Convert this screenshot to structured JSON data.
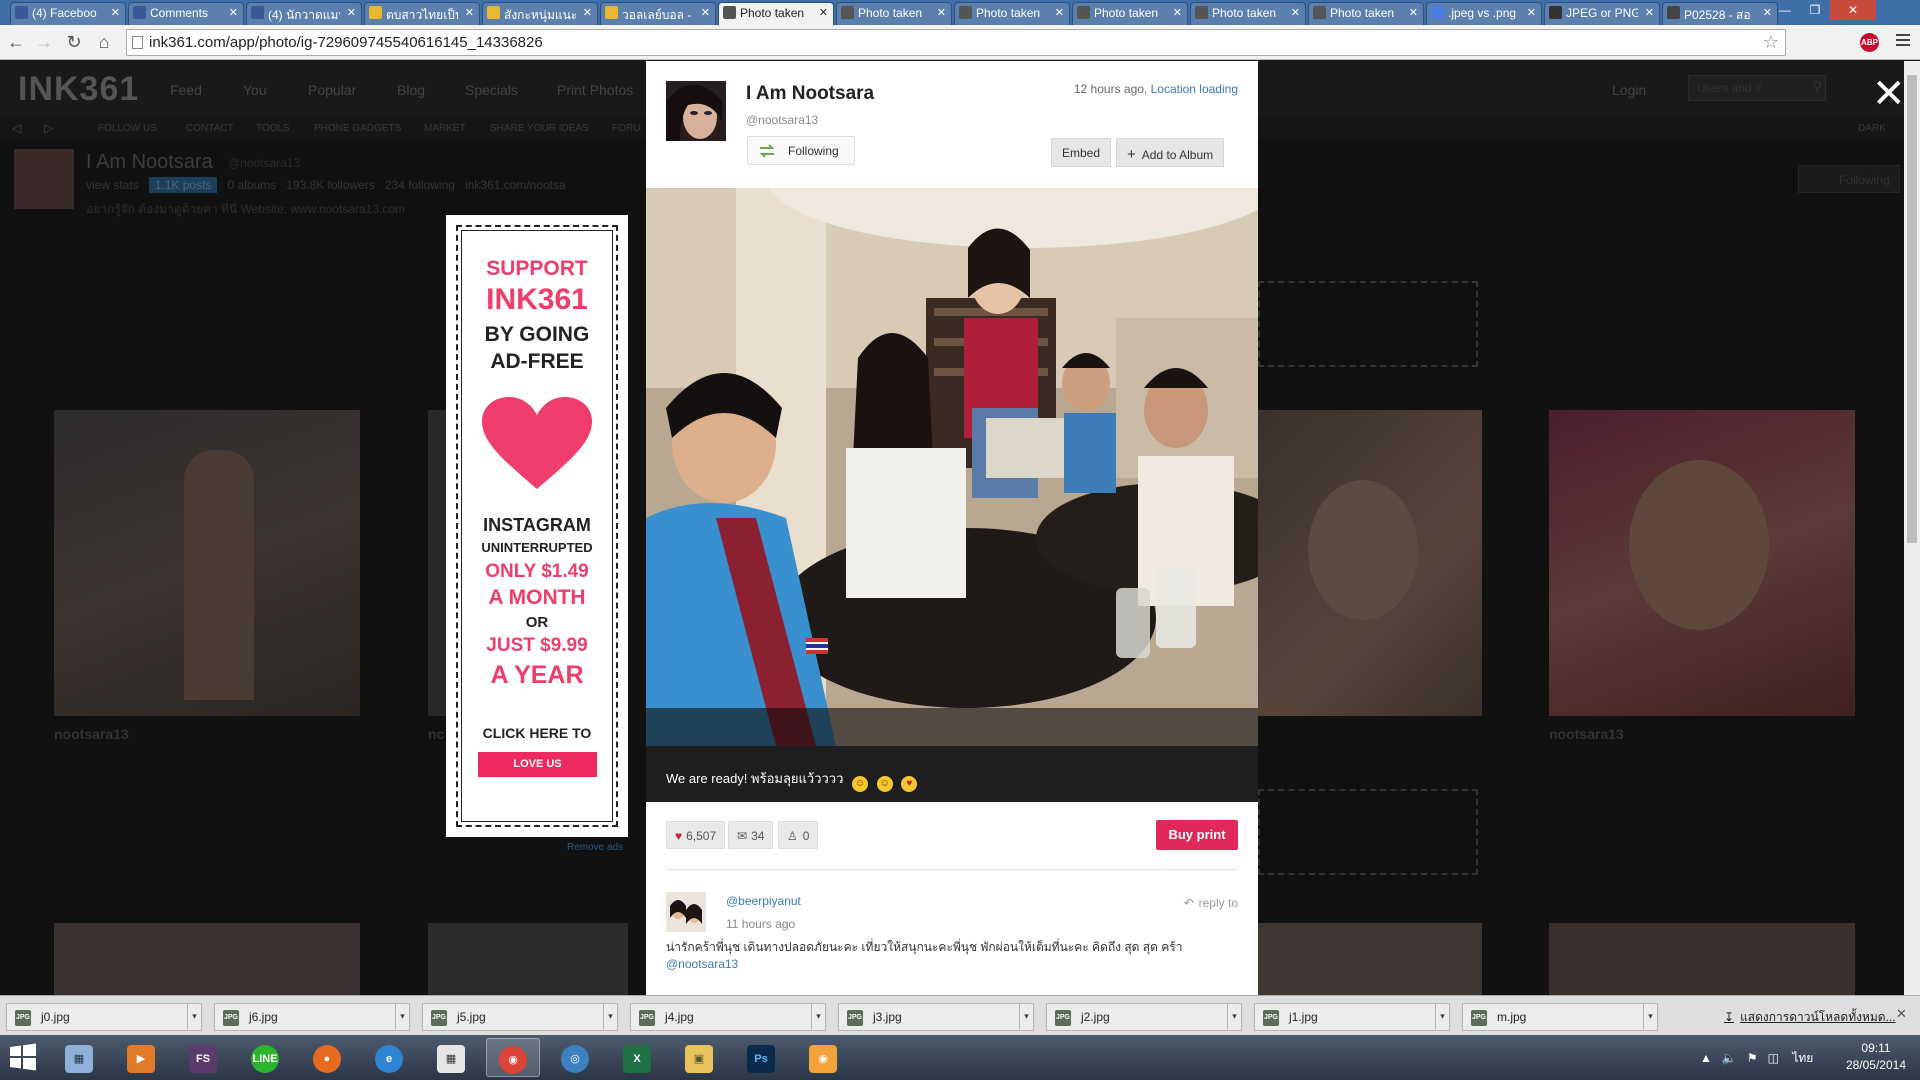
{
  "browser": {
    "tabs": [
      {
        "label": "(4) Faceboo",
        "icon": "facebook-icon",
        "color": "#3b5998"
      },
      {
        "label": "Comments",
        "icon": "facebook-icon",
        "color": "#3b5998"
      },
      {
        "label": "(4) นักวาดแมปป์",
        "icon": "facebook-icon",
        "color": "#3b5998"
      },
      {
        "label": "ตบสาวไทยเป็น",
        "icon": "smiley-icon",
        "color": "#e8b830"
      },
      {
        "label": "สังกะหนุ่มแนะ",
        "icon": "smiley-icon",
        "color": "#e8b830"
      },
      {
        "label": "วอลเลย์บอล -",
        "icon": "smiley-icon",
        "color": "#e8b830"
      },
      {
        "label": "Photo taken",
        "icon": "ink361-icon",
        "color": "#555555"
      },
      {
        "label": "Photo taken",
        "icon": "ink361-icon",
        "color": "#555555"
      },
      {
        "label": "Photo taken",
        "icon": "ink361-icon",
        "color": "#555555"
      },
      {
        "label": "Photo taken",
        "icon": "ink361-icon",
        "color": "#555555"
      },
      {
        "label": "Photo taken",
        "icon": "ink361-icon",
        "color": "#555555"
      },
      {
        "label": "Photo taken",
        "icon": "ink361-icon",
        "color": "#555555"
      },
      {
        "label": ".jpeg vs .png",
        "icon": "google-icon",
        "color": "#4a7fe3"
      },
      {
        "label": "JPEG or PNG",
        "icon": "di-icon",
        "color": "#333333"
      },
      {
        "label": "P02528 - สอ",
        "icon": "p-icon",
        "color": "#444444"
      }
    ],
    "active_tab": 6,
    "url": "ink361.com/app/photo/ig-729609745540616145_14336826"
  },
  "site": {
    "logo": "INK361",
    "nav": [
      "Feed",
      "You",
      "Popular",
      "Blog",
      "Specials",
      "Print Photos"
    ],
    "login": "Login",
    "user_search_placeholder": "Users and #",
    "subnav": [
      "FOLLOW US",
      "CONTACT",
      "TOOLS",
      "PHONE GADGETS",
      "MARKET",
      "SHARE YOUR IDEAS",
      "FORU"
    ],
    "subnav_right": "DARK",
    "profile": {
      "name": "I Am Nootsara",
      "handle": "@nootsara13",
      "view_stats": "view stats",
      "posts": "1.1K posts",
      "albums": "0 albums",
      "followers": "193.8K followers",
      "following": "234 following",
      "link": "ink361.com/nootsa",
      "bio": "อยากรู้จัก ต้องมาดูด้วยตา ที่นี่ Website: www.nootsara13.com",
      "follow_button": "Following"
    },
    "thumb_captions": [
      "nootsara13",
      "nc",
      "",
      "nootsara13"
    ]
  },
  "ad": {
    "line1": "SUPPORT",
    "line2": "INK361",
    "line3": "BY GOING",
    "line4": "AD-FREE",
    "line5": "INSTAGRAM",
    "line6": "UNINTERRUPTED",
    "line7": "ONLY $1.49",
    "line8": "A MONTH",
    "line9": "OR",
    "line10": "JUST $9.99",
    "line11": "A YEAR",
    "line12": "CLICK HERE TO",
    "button": "LOVE US",
    "remove_ads": "Remove ads",
    "heart_color": "#ef3e6b"
  },
  "modal": {
    "user_name": "I Am Nootsara",
    "handle": "@nootsara13",
    "time": "12 hours ago,",
    "location": "Location loading",
    "follow_button": "Following",
    "embed_button": "Embed",
    "add_album_button": "Add to Album",
    "caption": "We are ready! พร้อมลุยแว้วววว",
    "likes": "6,507",
    "comments": "34",
    "people": "0",
    "buy_print": "Buy print",
    "comment": {
      "user": "@beerpiyanut",
      "time": "11 hours ago",
      "reply": "reply to",
      "text": "น่ารักคร้าพี่นุช เดินทางปลอดภัยนะคะ เที่ยวให้สนุกนะคะพี่นุช พักผ่อนให้เต็มที่นะคะ คิดถึง สุด สุด คร้า",
      "mention": "@nootsara13"
    }
  },
  "downloads": {
    "files": [
      "j0.jpg",
      "j6.jpg",
      "j5.jpg",
      "j4.jpg",
      "j3.jpg",
      "j2.jpg",
      "j1.jpg",
      "m.jpg"
    ],
    "show_all": "แสดงการดาวน์โหลดทั้งหมด..."
  },
  "taskbar": {
    "time": "09:11",
    "date": "28/05/2014",
    "language": "ไทย"
  }
}
